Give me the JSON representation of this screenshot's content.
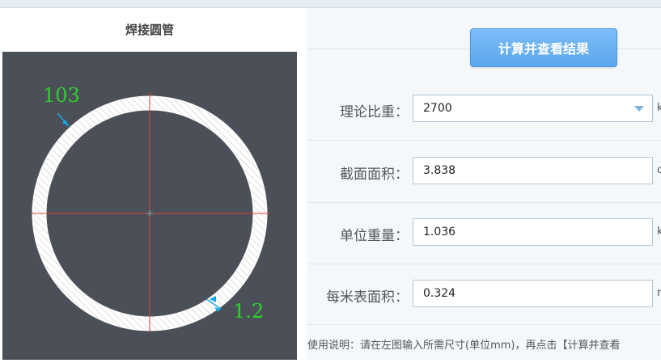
{
  "left": {
    "title": "焊接圆管",
    "drawing": {
      "outer_label": "103",
      "thickness_label": "1.2",
      "label_color": "#2bd42b",
      "axis_color": "#e0403a",
      "arrow_color": "#1aa7e8"
    }
  },
  "actions": {
    "calculate_label": "计算并查看结果"
  },
  "form": {
    "density": {
      "label": "理论比重：",
      "value": "2700",
      "unit": "k"
    },
    "area": {
      "label": "截面面积：",
      "value": "3.838",
      "unit": "c"
    },
    "unit_weight": {
      "label": "单位重量：",
      "value": "1.036",
      "unit": "k"
    },
    "surface_area": {
      "label": "每米表面积：",
      "value": "0.324",
      "unit": "m"
    }
  },
  "usage_text": "使用说明：请在左图输入所需尺寸(单位mm)，再点击【计算并查看",
  "colors": {
    "accent": "#5aa6ee",
    "canvas_bg": "#4b4f57"
  }
}
